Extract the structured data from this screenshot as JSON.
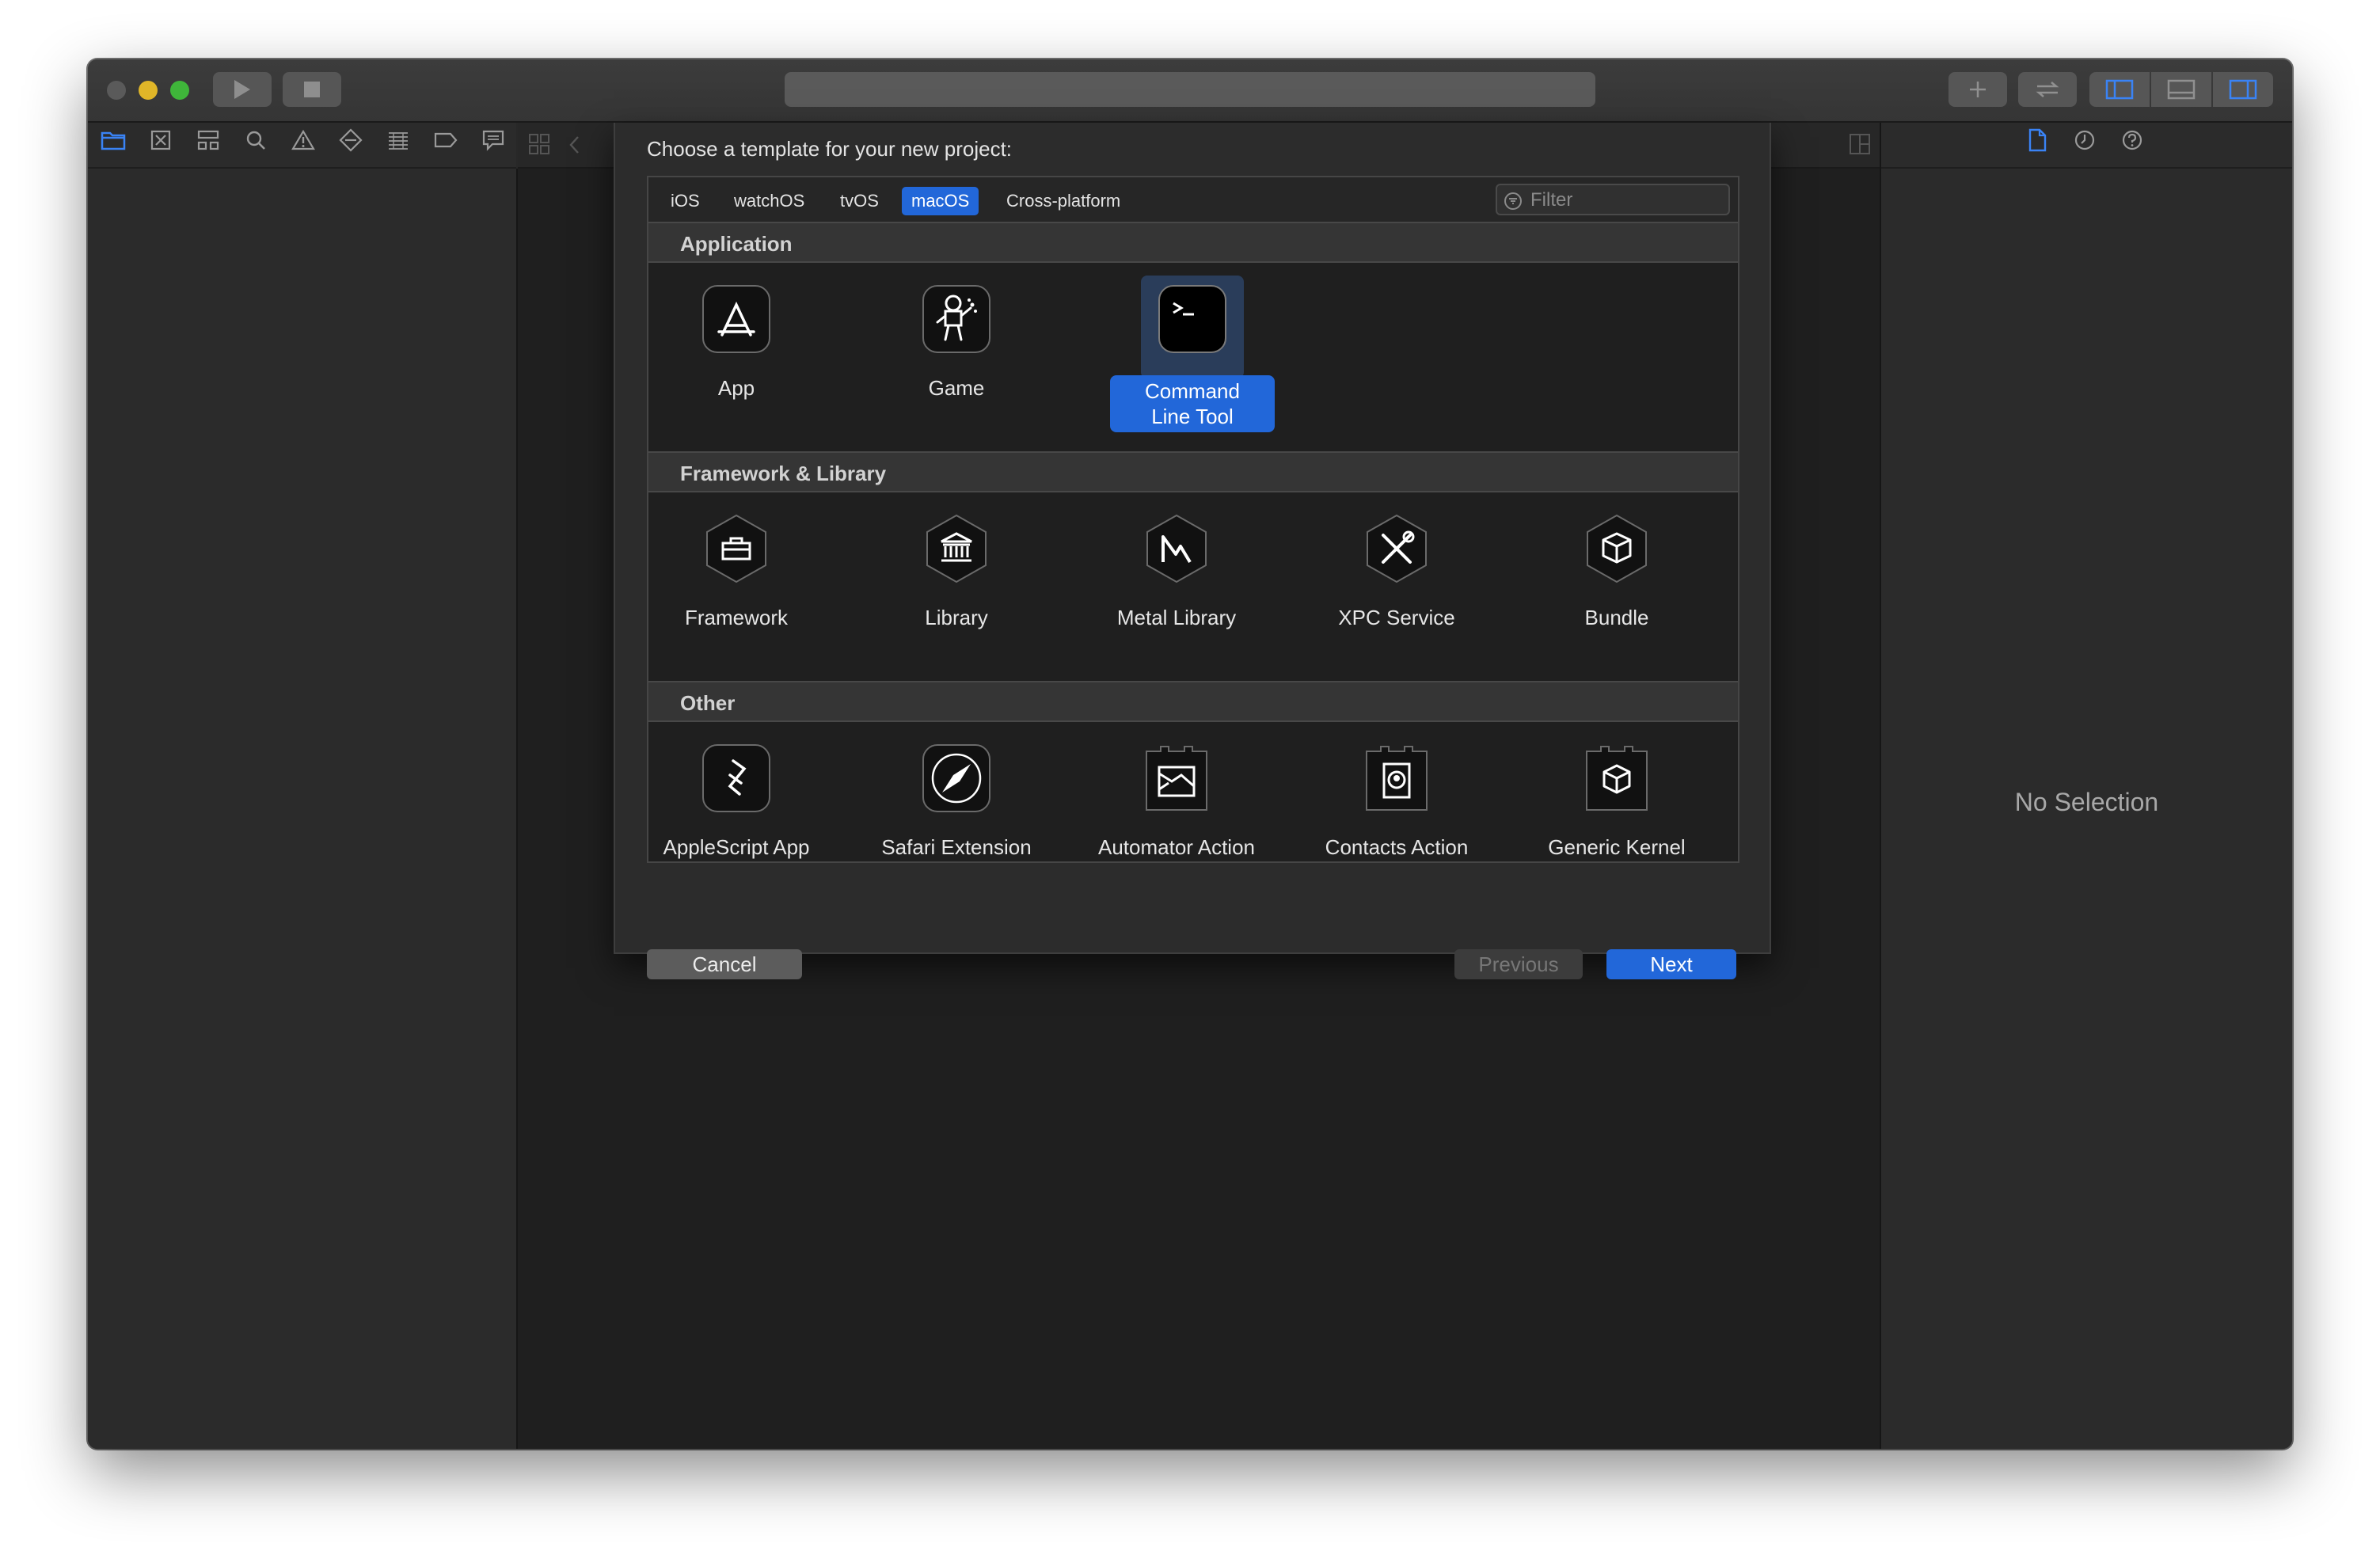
{
  "window": {
    "traffic_lights": [
      "close",
      "minimize",
      "zoom"
    ]
  },
  "toolbar": {
    "run_button_icon": "play-icon",
    "stop_button_icon": "stop-icon",
    "right_buttons": [
      "plus-icon",
      "swap-arrows-icon",
      "left-panel-icon",
      "bottom-panel-icon",
      "right-panel-icon"
    ]
  },
  "navigator": {
    "icons": [
      "folder-icon",
      "source-control-icon",
      "hierarchy-icon",
      "search-icon",
      "warning-icon",
      "test-icon",
      "debug-icon",
      "breakpoint-icon",
      "report-icon"
    ]
  },
  "inspector": {
    "icons": [
      "file-icon",
      "history-icon",
      "help-icon"
    ],
    "empty_text": "No Selection"
  },
  "sheet": {
    "title": "Choose a template for your new project:",
    "tabs": [
      {
        "label": "iOS",
        "active": false
      },
      {
        "label": "watchOS",
        "active": false
      },
      {
        "label": "tvOS",
        "active": false
      },
      {
        "label": "macOS",
        "active": true
      },
      {
        "label": "Cross-platform",
        "active": false
      }
    ],
    "filter_placeholder": "Filter",
    "sections": [
      {
        "title": "Application",
        "templates": [
          {
            "label": "App",
            "icon": "app-store-a-icon",
            "selected": false
          },
          {
            "label": "Game",
            "icon": "game-robot-icon",
            "selected": false
          },
          {
            "label": "Command\nLine Tool",
            "icon": "terminal-icon",
            "selected": true
          }
        ]
      },
      {
        "title": "Framework & Library",
        "templates": [
          {
            "label": "Framework",
            "icon": "toolbox-icon",
            "selected": false
          },
          {
            "label": "Library",
            "icon": "library-building-icon",
            "selected": false
          },
          {
            "label": "Metal Library",
            "icon": "metal-icon",
            "selected": false
          },
          {
            "label": "XPC Service",
            "icon": "tools-icon",
            "selected": false
          },
          {
            "label": "Bundle",
            "icon": "box-icon",
            "selected": false
          }
        ]
      },
      {
        "title": "Other",
        "templates": [
          {
            "label": "AppleScript App",
            "icon": "applescript-icon",
            "selected": false
          },
          {
            "label": "Safari Extension",
            "icon": "compass-icon",
            "selected": false
          },
          {
            "label": "Automator Action",
            "icon": "automator-icon",
            "selected": false
          },
          {
            "label": "Contacts Action",
            "icon": "contacts-icon",
            "selected": false
          },
          {
            "label": "Generic Kernel",
            "icon": "kernel-box-icon",
            "selected": false
          }
        ]
      }
    ],
    "buttons": {
      "cancel": "Cancel",
      "previous": "Previous",
      "next": "Next"
    }
  },
  "colors": {
    "accent": "#2267d9",
    "close": "#ff5f57",
    "minimize": "#febc2e",
    "zoom": "#28c840"
  }
}
